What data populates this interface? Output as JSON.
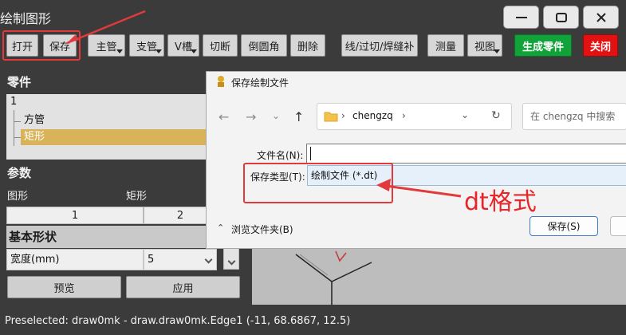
{
  "window": {
    "title": "绘制图形"
  },
  "toolbar": {
    "open": "打开",
    "save": "保存",
    "main_pipe": "主管",
    "branch_pipe": "支管",
    "v_groove": "V槽",
    "cut": "切断",
    "fillet": "倒圆角",
    "delete": "删除",
    "weld_line": "线/过切/焊缝补",
    "measure": "测量",
    "view": "视图",
    "generate": "生成零件",
    "close": "关闭"
  },
  "parts": {
    "heading": "零件",
    "root": "1",
    "items": [
      "方管",
      "矩形"
    ],
    "selected_index": 1
  },
  "params": {
    "heading": "参数",
    "shape_label": "图形",
    "shape_value": "矩形",
    "col1": "1",
    "col2": "2",
    "group": "基本形状",
    "width_label": "宽度(mm)",
    "width_value": "5",
    "preview": "预览",
    "apply": "应用"
  },
  "status": {
    "text": "Preselected: draw0mk - draw.draw0mk.Edge1 (-11, 68.6867, 12.5)"
  },
  "dialog": {
    "title": "保存绘制文件",
    "path": "chengzq",
    "search_placeholder": "在 chengzq 中搜索",
    "filename_label": "文件名(N):",
    "filename_value": "",
    "type_label": "保存类型(T):",
    "type_value": "绘制文件 (*.dt)",
    "browse": "浏览文件夹(B)",
    "save_button": "保存(S)"
  },
  "annotation": {
    "text": "dt格式",
    "color": "#e6262b"
  },
  "colors": {
    "accent_box": "#e23a3a",
    "selection": "#d9b35a",
    "generate_bg": "#12a23a",
    "close_bg": "#e31212"
  }
}
